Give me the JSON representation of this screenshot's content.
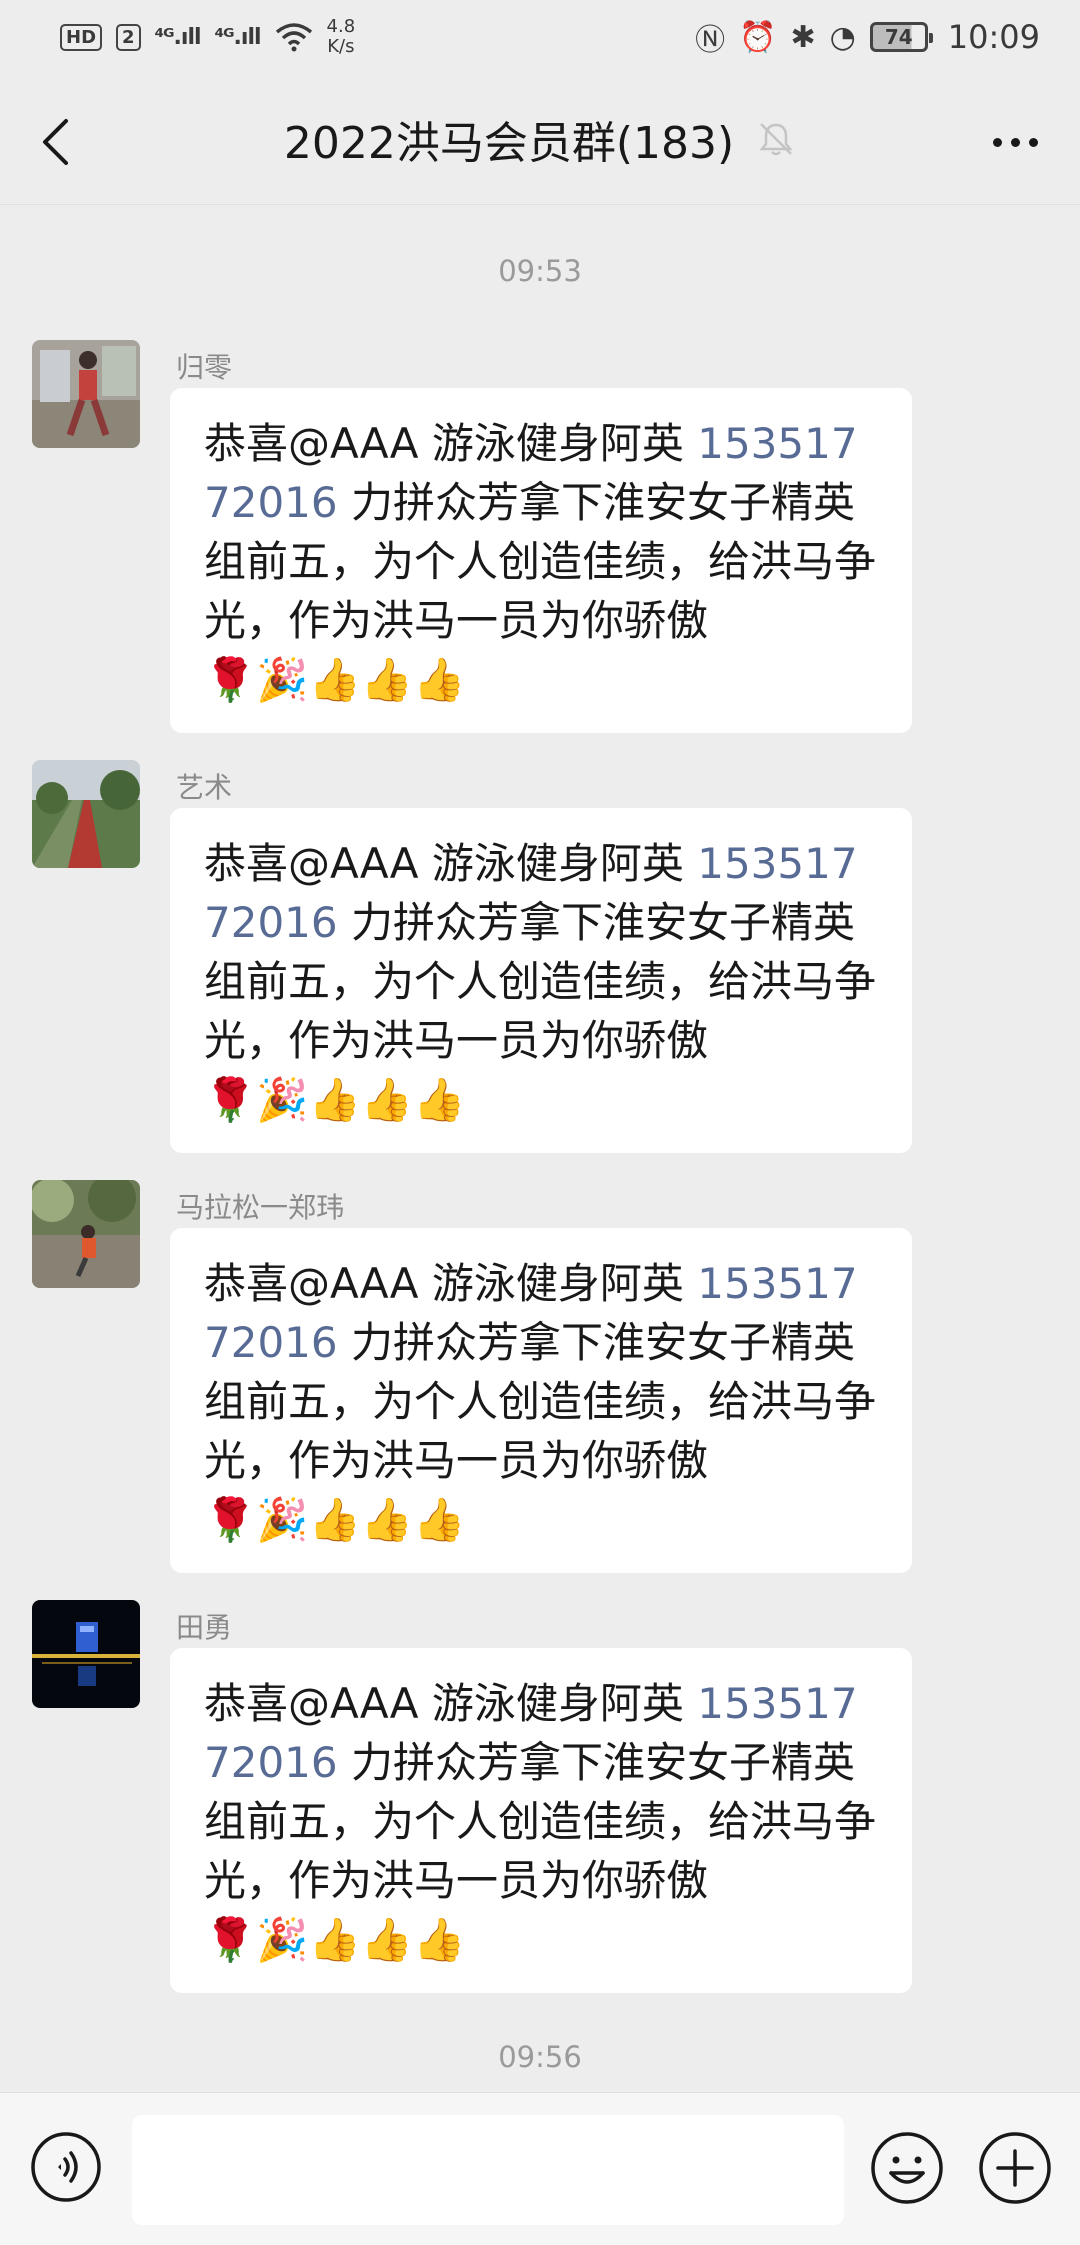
{
  "status_bar": {
    "hd": "HD",
    "sim": "2",
    "signal1": "⁴ᴳ.ıll",
    "signal2": "⁴ᴳ.ıll",
    "speed_value": "4.8",
    "speed_unit": "K/s",
    "battery": "74",
    "time": "10:09",
    "icons": [
      "hd-icon",
      "signal-icon",
      "wifi-icon",
      "nfc-icon",
      "alarm-icon",
      "bluetooth-icon",
      "speed-icon",
      "battery-icon"
    ]
  },
  "header": {
    "title": "2022洪马会员群(183)",
    "back_icon": "chevron-left-icon",
    "mute_icon": "bell-off-icon",
    "more_icon": "more-icon"
  },
  "timestamps": [
    "09:53",
    "09:56"
  ],
  "messages": [
    {
      "sender": "归零",
      "text_before": "恭喜@AAA 游泳健身阿英 ",
      "phone": "15351772016",
      "text_after": " 力拼众芳拿下淮安女子精英组前五，为个人创造佳绩，给洪马争光，作为洪马一员为你骄傲",
      "emojis": "🌹🎉👍👍👍"
    },
    {
      "sender": "艺术",
      "text_before": "恭喜@AAA 游泳健身阿英 ",
      "phone": "15351772016",
      "text_after": " 力拼众芳拿下淮安女子精英组前五，为个人创造佳绩，给洪马争光，作为洪马一员为你骄傲",
      "emojis": "🌹🎉👍👍👍"
    },
    {
      "sender": "马拉松一郑玮",
      "text_before": "恭喜@AAA 游泳健身阿英 ",
      "phone": "15351772016",
      "text_after": " 力拼众芳拿下淮安女子精英组前五，为个人创造佳绩，给洪马争光，作为洪马一员为你骄傲",
      "emojis": "🌹🎉👍👍👍"
    },
    {
      "sender": "田勇",
      "text_before": "恭喜@AAA 游泳健身阿英 ",
      "phone": "15351772016",
      "text_after": " 力拼众芳拿下淮安女子精英组前五，为个人创造佳绩，给洪马争光，作为洪马一员为你骄傲",
      "emojis": "🌹🎉👍👍👍"
    }
  ],
  "input_bar": {
    "voice_icon": "voice-icon",
    "emoji_icon": "smiley-icon",
    "plus_icon": "plus-icon",
    "input_value": ""
  },
  "colors": {
    "background": "#ededed",
    "bubble": "#ffffff",
    "link": "#576b95",
    "time": "#9a9a9a"
  }
}
